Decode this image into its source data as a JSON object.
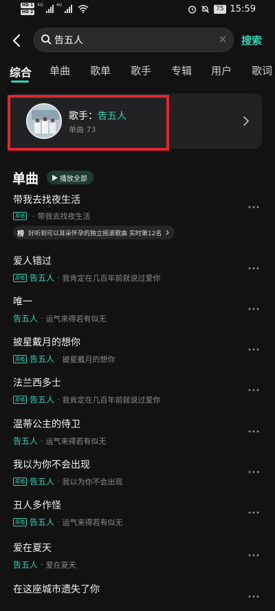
{
  "status_bar": {
    "hd1": "HD 1",
    "hd2": "HD 2",
    "net1": "5G",
    "net2": "4G",
    "battery": "75",
    "time": "15:59"
  },
  "search": {
    "value": "告五人",
    "submit_label": "搜索"
  },
  "tabs": [
    "综合",
    "单曲",
    "歌单",
    "歌手",
    "专辑",
    "用户",
    "歌词"
  ],
  "artist_card": {
    "prefix": "歌手：",
    "name": "告五人",
    "subtitle": "单曲 73"
  },
  "section": {
    "title": "单曲",
    "play_all": "播放全部"
  },
  "songs": [
    {
      "title": "带我去找夜生活",
      "has_badge": true,
      "badge": "原唱",
      "singer": "",
      "album": "带我去找夜生活",
      "chart_glyph": "榜",
      "chart_text": "好听到可以耳朵怀孕的独立摇滚歌曲 实时第12名"
    },
    {
      "title": "爱人错过",
      "has_badge": true,
      "badge": "原唱",
      "singer": "告五人",
      "album": "我肯定在几百年前就说过爱你"
    },
    {
      "title": "唯一",
      "has_badge": false,
      "singer": "告五人",
      "album": "运气来得若有似无"
    },
    {
      "title": "披星戴月的想你",
      "has_badge": true,
      "badge": "原唱",
      "singer": "告五人",
      "album": "披星戴月的想你"
    },
    {
      "title": "法兰西多士",
      "has_badge": true,
      "badge": "原唱",
      "singer": "告五人",
      "album": "我肯定在几百年前就说过爱你"
    },
    {
      "title": "温蒂公主的侍卫",
      "has_badge": false,
      "singer": "告五人",
      "album": "运气来得若有似无"
    },
    {
      "title": "我以为你不会出现",
      "has_badge": true,
      "badge": "原唱",
      "singer": "告五人",
      "album": "我以为你不会出现"
    },
    {
      "title": "丑人多作怪",
      "has_badge": true,
      "badge": "原唱",
      "singer": "告五人",
      "album": "运气来得若有似无"
    },
    {
      "title": "爱在夏天",
      "has_badge": false,
      "singer": "告五人",
      "album": "爱在夏天"
    },
    {
      "title": "在这座城市遗失了你",
      "has_badge": false,
      "singer": "",
      "album": ""
    }
  ],
  "colors": {
    "accent": "#35d2b5",
    "background": "#121212",
    "highlight_frame": "#e2262b"
  }
}
